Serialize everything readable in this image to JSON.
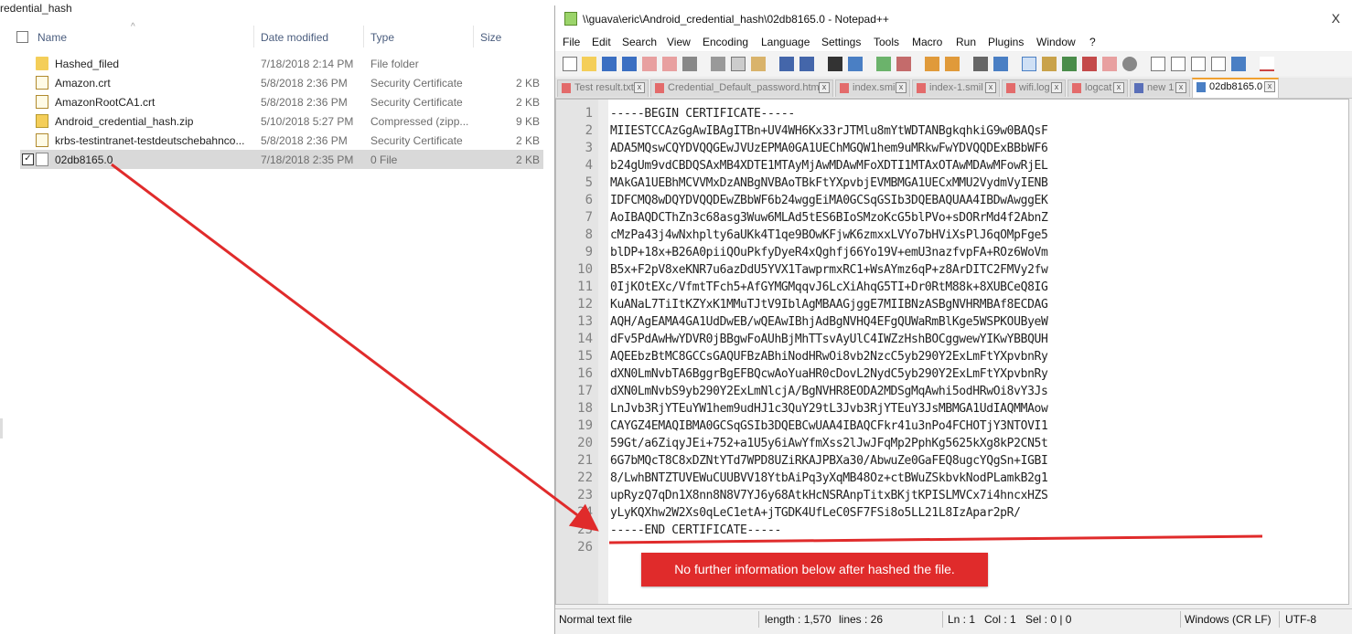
{
  "explorer": {
    "folder_title": "redential_hash",
    "columns": {
      "name": "Name",
      "date": "Date modified",
      "type": "Type",
      "size": "Size"
    },
    "files": [
      {
        "name": "Hashed_filed",
        "date": "7/18/2018 2:14 PM",
        "type": "File folder",
        "size": "",
        "icon": "folder-icon"
      },
      {
        "name": "Amazon.crt",
        "date": "5/8/2018 2:36 PM",
        "type": "Security Certificate",
        "size": "2 KB",
        "icon": "certificate-icon"
      },
      {
        "name": "AmazonRootCA1.crt",
        "date": "5/8/2018 2:36 PM",
        "type": "Security Certificate",
        "size": "2 KB",
        "icon": "certificate-icon"
      },
      {
        "name": "Android_credential_hash.zip",
        "date": "5/10/2018 5:27 PM",
        "type": "Compressed (zipp...",
        "size": "9 KB",
        "icon": "zip-icon"
      },
      {
        "name": "krbs-testintranet-testdeutschebahnco...",
        "date": "5/8/2018 2:36 PM",
        "type": "Security Certificate",
        "size": "2 KB",
        "icon": "certificate-icon"
      },
      {
        "name": "02db8165.0",
        "date": "7/18/2018 2:35 PM",
        "type": "0 File",
        "size": "2 KB",
        "icon": "file-icon",
        "selected": true
      }
    ]
  },
  "npp": {
    "title": "\\\\guava\\eric\\Android_credential_hash\\02db8165.0 - Notepad++",
    "close": "X",
    "menu": [
      "File",
      "Edit",
      "Search",
      "View",
      "Encoding",
      "Language",
      "Settings",
      "Tools",
      "Macro",
      "Run",
      "Plugins",
      "Window",
      "?"
    ],
    "tabs": [
      {
        "label": "Test result.txt",
        "active": false
      },
      {
        "label": "Credential_Default_password.html",
        "active": false
      },
      {
        "label": "index.smil",
        "active": false
      },
      {
        "label": "index-1.smil",
        "active": false
      },
      {
        "label": "wifi.log",
        "active": false
      },
      {
        "label": "logcat",
        "active": false
      },
      {
        "label": "new 1",
        "active": false
      },
      {
        "label": "02db8165.0",
        "active": true
      }
    ],
    "lines": [
      "-----BEGIN CERTIFICATE-----",
      "MIIESTCCAzGgAwIBAgITBn+UV4WH6Kx33rJTMlu8mYtWDTANBgkqhkiG9w0BAQsF",
      "ADA5MQswCQYDVQQGEwJVUzEPMA0GA1UEChMGQW1hem9uMRkwFwYDVQQDExBBbWF6",
      "b24gUm9vdCBDQSAxMB4XDTE1MTAyMjAwMDAwMFoXDTI1MTAxOTAwMDAwMFowRjEL",
      "MAkGA1UEBhMCVVMxDzANBgNVBAoTBkFtYXpvbjEVMBMGA1UECxMMU2VydmVyIENB",
      "IDFCMQ8wDQYDVQQDEwZBbWF6b24wggEiMA0GCSqGSIb3DQEBAQUAA4IBDwAwggEK",
      "AoIBAQDCThZn3c68asg3Wuw6MLAd5tES6BIoSMzoKcG5blPVo+sDORrMd4f2AbnZ",
      "cMzPa43j4wNxhplty6aUKk4T1qe9BOwKFjwK6zmxxLVYo7bHViXsPlJ6qOMpFge5",
      "blDP+18x+B26A0piiQOuPkfyDyeR4xQghfj66Yo19V+emU3nazfvpFA+ROz6WoVm",
      "B5x+F2pV8xeKNR7u6azDdU5YVX1TawprmxRC1+WsAYmz6qP+z8ArDITC2FMVy2fw",
      "0IjKOtEXc/VfmtTFch5+AfGYMGMqqvJ6LcXiAhqG5TI+Dr0RtM88k+8XUBCeQ8IG",
      "KuANaL7TiItKZYxK1MMuTJtV9IblAgMBAAGjggE7MIIBNzASBgNVHRMBAf8ECDAG",
      "AQH/AgEAMA4GA1UdDwEB/wQEAwIBhjAdBgNVHQ4EFgQUWaRmBlKge5WSPKOUByeW",
      "dFv5PdAwHwYDVR0jBBgwFoAUhBjMhTTsvAyUlC4IWZzHshBOCggwewYIKwYBBQUH",
      "AQEEbzBtMC8GCCsGAQUFBzABhiNodHRwOi8vb2NzcC5yb290Y2ExLmFtYXpvbnRy",
      "dXN0LmNvbTA6BggrBgEFBQcwAoYuaHR0cDovL2NydC5yb290Y2ExLmFtYXpvbnRy",
      "dXN0LmNvbS9yb290Y2ExLmNlcjA/BgNVHR8EODA2MDSgMqAwhi5odHRwOi8vY3Js",
      "LnJvb3RjYTEuYW1hem9udHJ1c3QuY29tL3Jvb3RjYTEuY3JsMBMGA1UdIAQMMAow",
      "CAYGZ4EMAQIBMA0GCSqGSIb3DQEBCwUAA4IBAQCFkr41u3nPo4FCHOTjY3NTOVI1",
      "59Gt/a6ZiqyJEi+752+a1U5y6iAwYfmXss2lJwJFqMp2PphKg5625kXg8kP2CN5t",
      "6G7bMQcT8C8xDZNtYTd7WPD8UZiRKAJPBXa30/AbwuZe0GaFEQ8ugcYQgSn+IGBI",
      "8/LwhBNTZTUVEWuCUUBVV18YtbAiPq3yXqMB48Oz+ctBWuZSkbvkNodPLamkB2g1",
      "upRyzQ7qDn1X8nn8N8V7YJ6y68AtkHcNSRAnpTitxBKjtKPISLMVCx7i4hncxHZS",
      "yLyKQXhw2W2Xs0qLeC1etA+jTGDK4UfLeC0SF7FSi8o5LL21L8IzApar2pR/",
      "-----END CERTIFICATE-----",
      ""
    ],
    "status": {
      "type": "Normal text file",
      "length": "length : 1,570",
      "lines": "lines : 26",
      "ln": "Ln : 1",
      "col": "Col : 1",
      "sel": "Sel : 0 | 0",
      "eol": "Windows (CR LF)",
      "encoding": "UTF-8"
    }
  },
  "annotation": {
    "callout_text": "No further information below after hashed the file.",
    "color": "#e02b2b"
  }
}
